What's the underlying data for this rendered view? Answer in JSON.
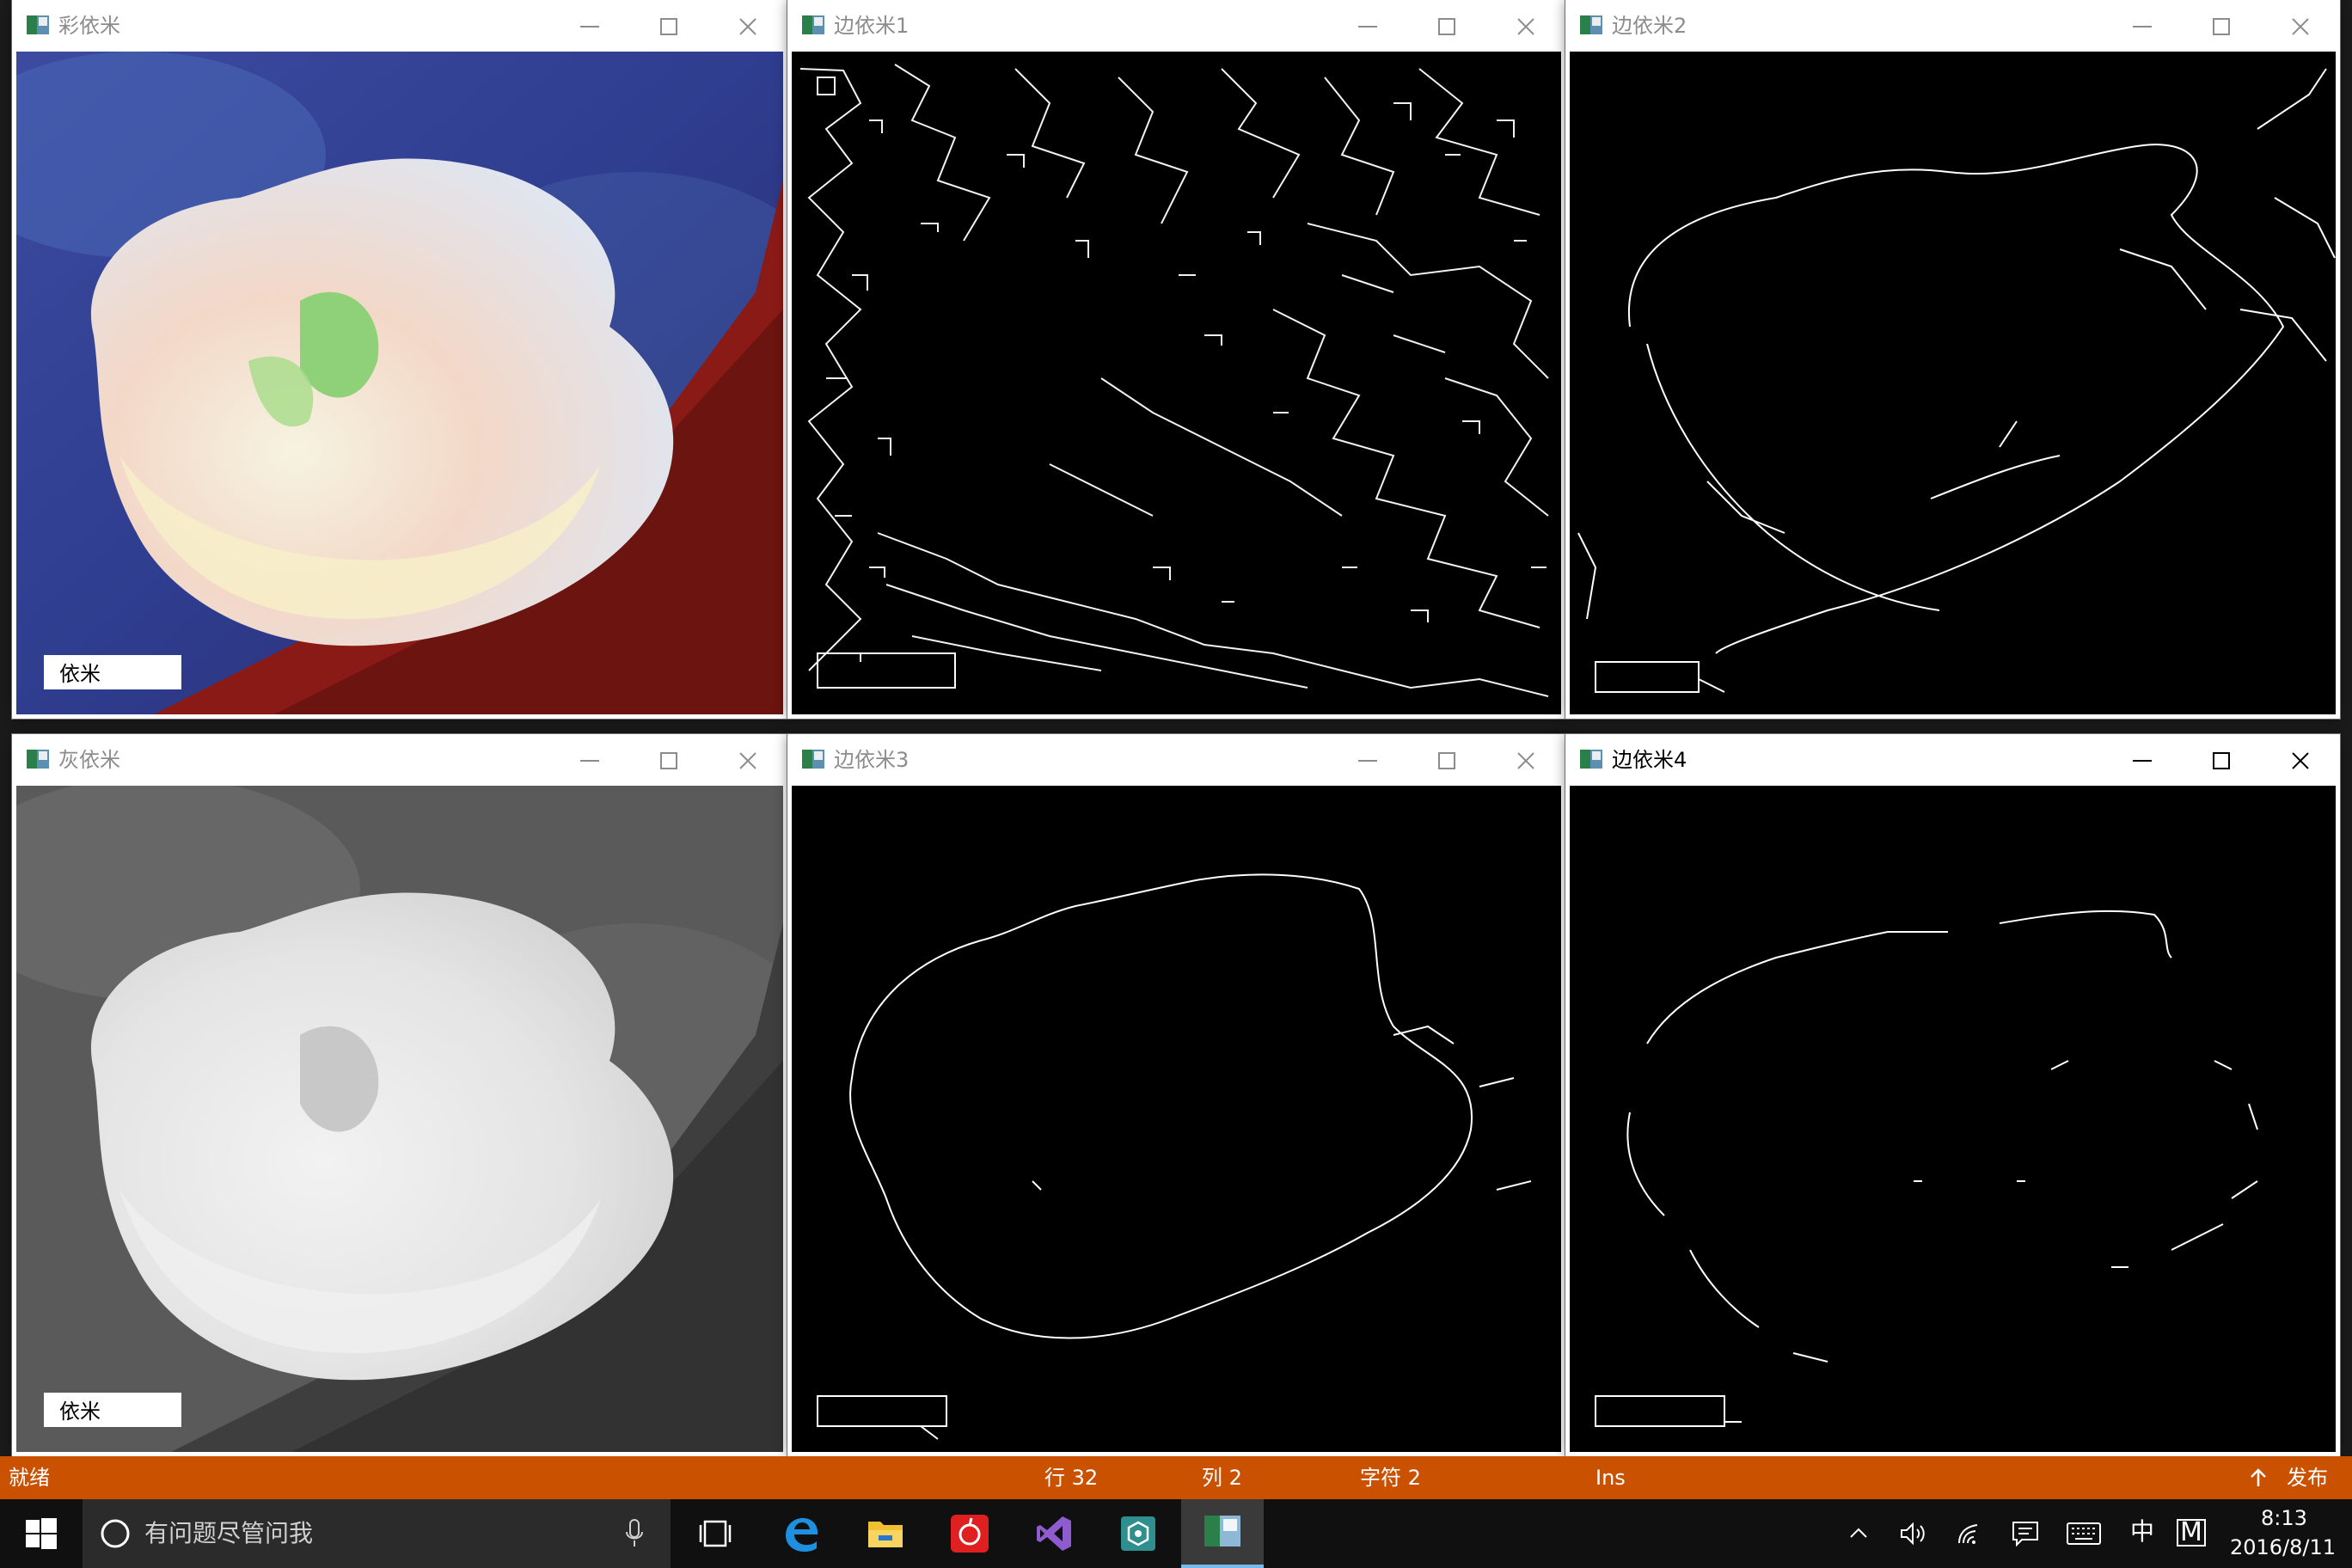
{
  "windows": [
    {
      "title": "彩依米",
      "image": "color flower photo with 依米 watermark",
      "label": "依米"
    },
    {
      "title": "边依米1",
      "image": "dense edge detection map"
    },
    {
      "title": "边依米2",
      "image": "edge detection map"
    },
    {
      "title": "灰依米",
      "image": "grayscale flower photo with 依米 watermark",
      "label": "依米"
    },
    {
      "title": "边依米3",
      "image": "flower outline edge map"
    },
    {
      "title": "边依米4",
      "image": "sparse flower outline edge map"
    }
  ],
  "window_icon": "opencv-window-icon",
  "controls": {
    "minimize": "minimize-icon",
    "maximize": "maximize-icon",
    "close": "close-icon"
  },
  "statusbar": {
    "ready": "就绪",
    "line": "行 32",
    "column": "列 2",
    "char": "字符 2",
    "mode": "Ins",
    "publish": "发布",
    "color": "#ca5100"
  },
  "taskbar": {
    "search_placeholder": "有问题尽管问我",
    "ime": "中",
    "ime_mode": "M",
    "time": "8:13",
    "date": "2016/8/11",
    "apps": [
      "task-view-icon",
      "edge-icon",
      "file-explorer-icon",
      "netease-music-icon",
      "visual-studio-icon",
      "app-icon",
      "opencv-window-icon"
    ]
  }
}
